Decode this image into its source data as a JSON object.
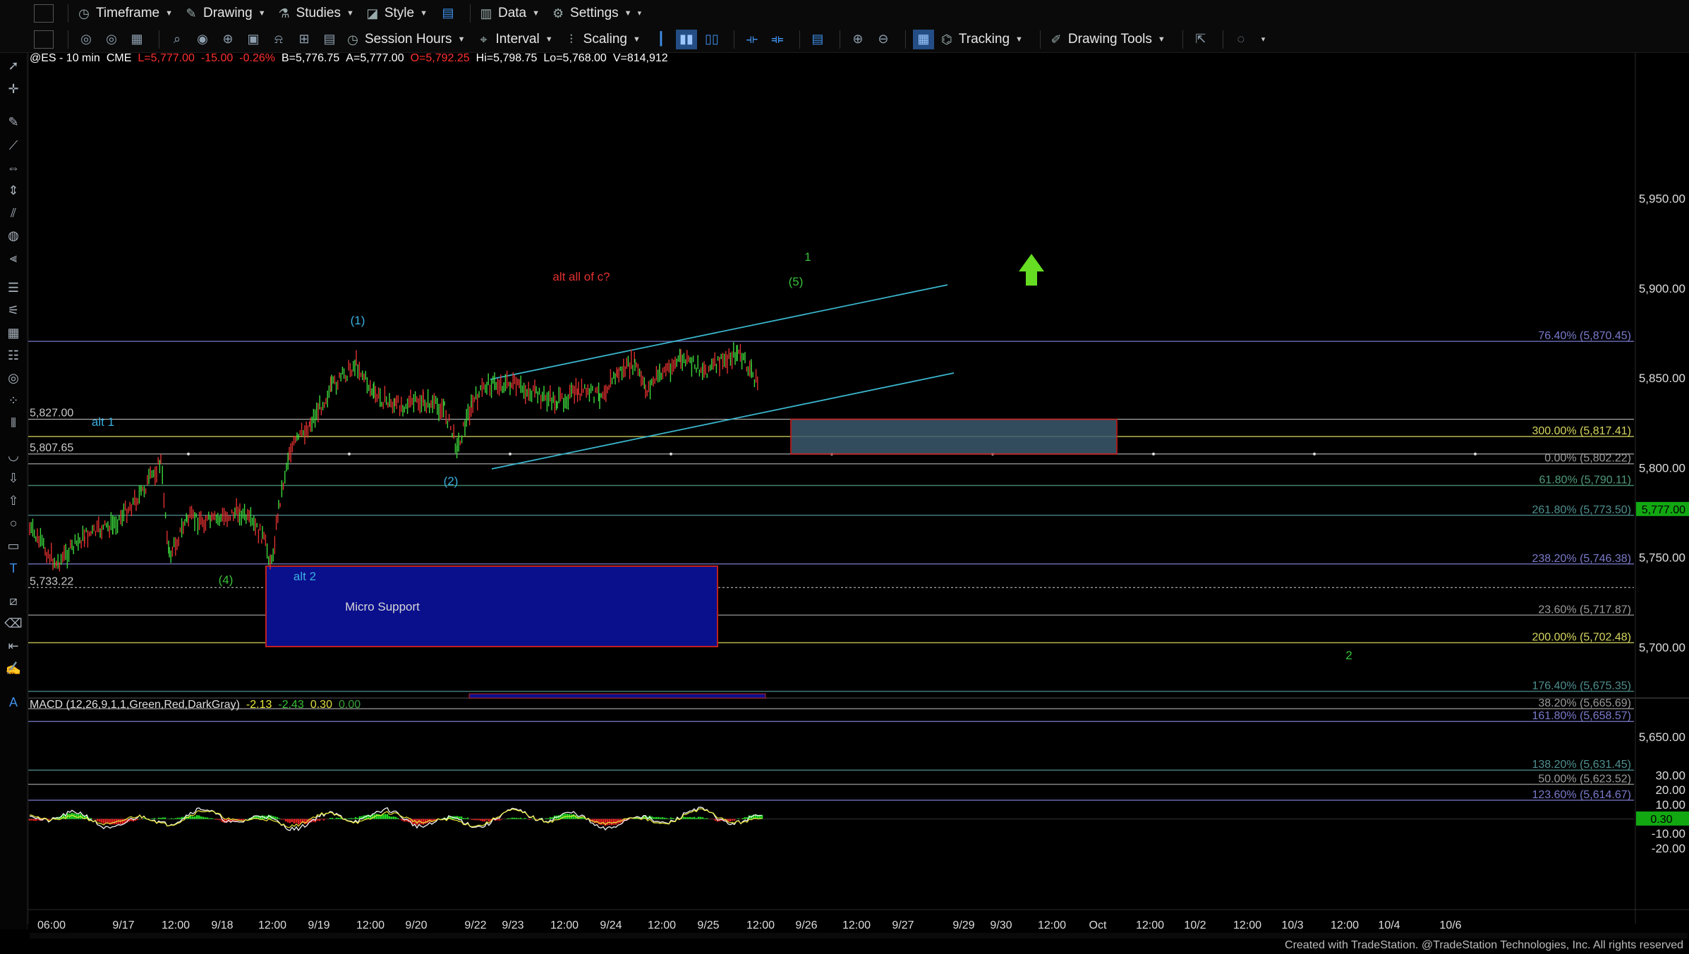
{
  "toolbar_top": {
    "items": [
      {
        "label": "Timeframe",
        "icon": "clock-icon"
      },
      {
        "label": "Drawing",
        "icon": "pencil-icon"
      },
      {
        "label": "Studies",
        "icon": "flask-icon"
      },
      {
        "label": "Style",
        "icon": "style-icon"
      },
      {
        "label": "Data",
        "icon": "bars-icon"
      },
      {
        "label": "Settings",
        "icon": "gear-icon"
      }
    ]
  },
  "toolbar_bottom": {
    "session_hours": "Session Hours",
    "interval": "Interval",
    "scaling": "Scaling",
    "tracking": "Tracking",
    "drawing_tools": "Drawing Tools"
  },
  "symbol_bar": {
    "symbol": "@ES - 10 min",
    "exchange": "CME",
    "last": "L=5,777.00",
    "change": "-15.00",
    "change_pct": "-0.26%",
    "bid": "B=5,776.75",
    "ask": "A=5,777.00",
    "open": "O=5,792.25",
    "high": "Hi=5,798.75",
    "low": "Lo=5,768.00",
    "volume": "V=814,912"
  },
  "macd": {
    "label": "MACD (12,26,9,1,1,Green,Red,DarkGray)",
    "v1": "-2.13",
    "v2": "-2.43",
    "v3": "0.30",
    "v4": "0.00",
    "current": "0.30",
    "ticks": [
      "30.00",
      "20.00",
      "10.00",
      "-10.00",
      "-20.00"
    ]
  },
  "price_axis": {
    "ticks": [
      "5,950.00",
      "5,900.00",
      "5,850.00",
      "5,800.00",
      "5,750.00",
      "5,700.00",
      "5,650.00"
    ],
    "current": "5,777.00"
  },
  "time_axis": {
    "labels": [
      "06:00",
      "9/17",
      "12:00",
      "9/18",
      "12:00",
      "9/19",
      "12:00",
      "9/20",
      "9/22",
      "9/23",
      "12:00",
      "9/24",
      "12:00",
      "9/25",
      "12:00",
      "9/26",
      "12:00",
      "9/27",
      "9/29",
      "9/30",
      "12:00",
      "Oct",
      "12:00",
      "10/2",
      "12:00",
      "10/3",
      "12:00",
      "10/4",
      "10/6"
    ]
  },
  "fib_levels": [
    {
      "label": "76.40% (5,870.45)",
      "price": 5870.45,
      "color": "#7a7acc"
    },
    {
      "label": "300.00% (5,817.41)",
      "price": 5817.41,
      "color": "#d6d660"
    },
    {
      "label": "0.00% (5,802.22)",
      "price": 5802.22,
      "color": "#9a9a9a"
    },
    {
      "label": "61.80% (5,790.11)",
      "price": 5790.11,
      "color": "#4f9a7c"
    },
    {
      "label": "261.80% (5,773.50)",
      "price": 5773.5,
      "color": "#4f8f8f"
    },
    {
      "label": "238.20% (5,746.38)",
      "price": 5746.38,
      "color": "#7a7acc"
    },
    {
      "label": "23.60% (5,717.87)",
      "price": 5717.87,
      "color": "#9a9a9a"
    },
    {
      "label": "200.00% (5,702.48)",
      "price": 5702.48,
      "color": "#d6d660"
    },
    {
      "label": "176.40% (5,675.35)",
      "price": 5675.35,
      "color": "#4f8f8f"
    },
    {
      "label": "38.20% (5,665.69)",
      "price": 5665.69,
      "color": "#9a9a9a"
    },
    {
      "label": "161.80% (5,658.57)",
      "price": 5658.57,
      "color": "#7a7acc"
    },
    {
      "label": "138.20% (5,631.45)",
      "price": 5631.45,
      "color": "#4f8f8f"
    },
    {
      "label": "50.00% (5,623.52)",
      "price": 5623.52,
      "color": "#9a9a9a"
    },
    {
      "label": "123.60% (5,614.67)",
      "price": 5614.67,
      "color": "#7a7acc"
    }
  ],
  "level_labels": [
    {
      "label": "5,827.00",
      "price": 5827.0
    },
    {
      "label": "5,807.65",
      "price": 5807.65
    },
    {
      "label": "5,733.22",
      "price": 5733.22
    }
  ],
  "annotations": [
    {
      "text": "alt all of c?",
      "color": "#e03030"
    },
    {
      "text": "1",
      "color": "#38c038"
    },
    {
      "text": "(5)",
      "color": "#38c038"
    },
    {
      "text": "(1)",
      "color": "#3ab0e0"
    },
    {
      "text": "alt 1",
      "color": "#3ab0e0"
    },
    {
      "text": "(2)",
      "color": "#3ab0e0"
    },
    {
      "text": "(4)",
      "color": "#38c038"
    },
    {
      "text": "alt 2",
      "color": "#3ab0e0"
    },
    {
      "text": "Micro Support",
      "color": "#d8d8d8"
    },
    {
      "text": "2",
      "color": "#38c038"
    }
  ],
  "footer": "Created with TradeStation. @TradeStation Technologies, Inc. All rights reserved"
}
